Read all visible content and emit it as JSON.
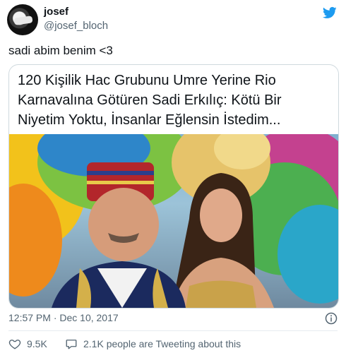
{
  "author": {
    "name": "josef",
    "handle": "@josef_bloch"
  },
  "tweet": {
    "text": "sadi abim benim <3"
  },
  "card": {
    "title_line1": "120 Kişilik Hac Grubunu Umre Yerine Rio",
    "title_line2": "Karnavalına Götüren Sadi Erkılıç: Kötü Bir",
    "title_line3": "Niyetim Yoktu, İnsanlar Eğlensin İstedim..."
  },
  "meta": {
    "timestamp": "12:57 PM · Dec 10, 2017",
    "likes": "9.5K",
    "replies_text": "2.1K people are Tweeting about this"
  },
  "icons": {
    "brand": "twitter-bird-icon",
    "info": "info-icon",
    "like": "heart-icon",
    "reply": "speech-bubble-icon"
  },
  "colors": {
    "brand": "#1d9bf0",
    "secondary_text": "#536471",
    "like": "#f91880"
  }
}
